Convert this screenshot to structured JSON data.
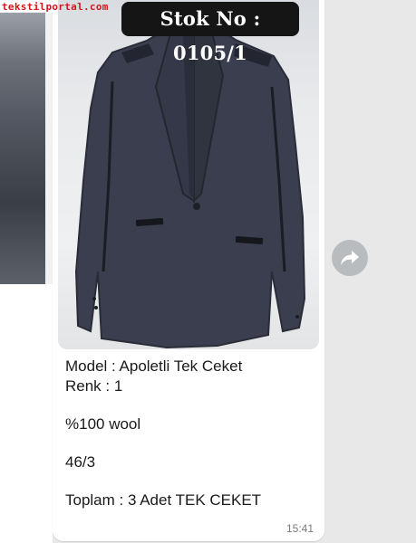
{
  "watermark": "tekstilportal.com",
  "message": {
    "stock_label": "Stok No : 0105/1",
    "caption": {
      "model": "Model : Apoletli Tek Ceket",
      "renk": "Renk : 1",
      "fabric": "%100 wool",
      "size": "46/3",
      "total": "Toplam : 3 Adet TEK CEKET"
    },
    "time": "15:41"
  },
  "actions": {
    "forward_icon": "forward-arrow-icon"
  },
  "colors": {
    "watermark": "#d8141a",
    "bubble": "#ffffff",
    "background": "#e8e8e8",
    "stock_label_bg": "#151515",
    "forward_button": "#b9bcbf"
  }
}
